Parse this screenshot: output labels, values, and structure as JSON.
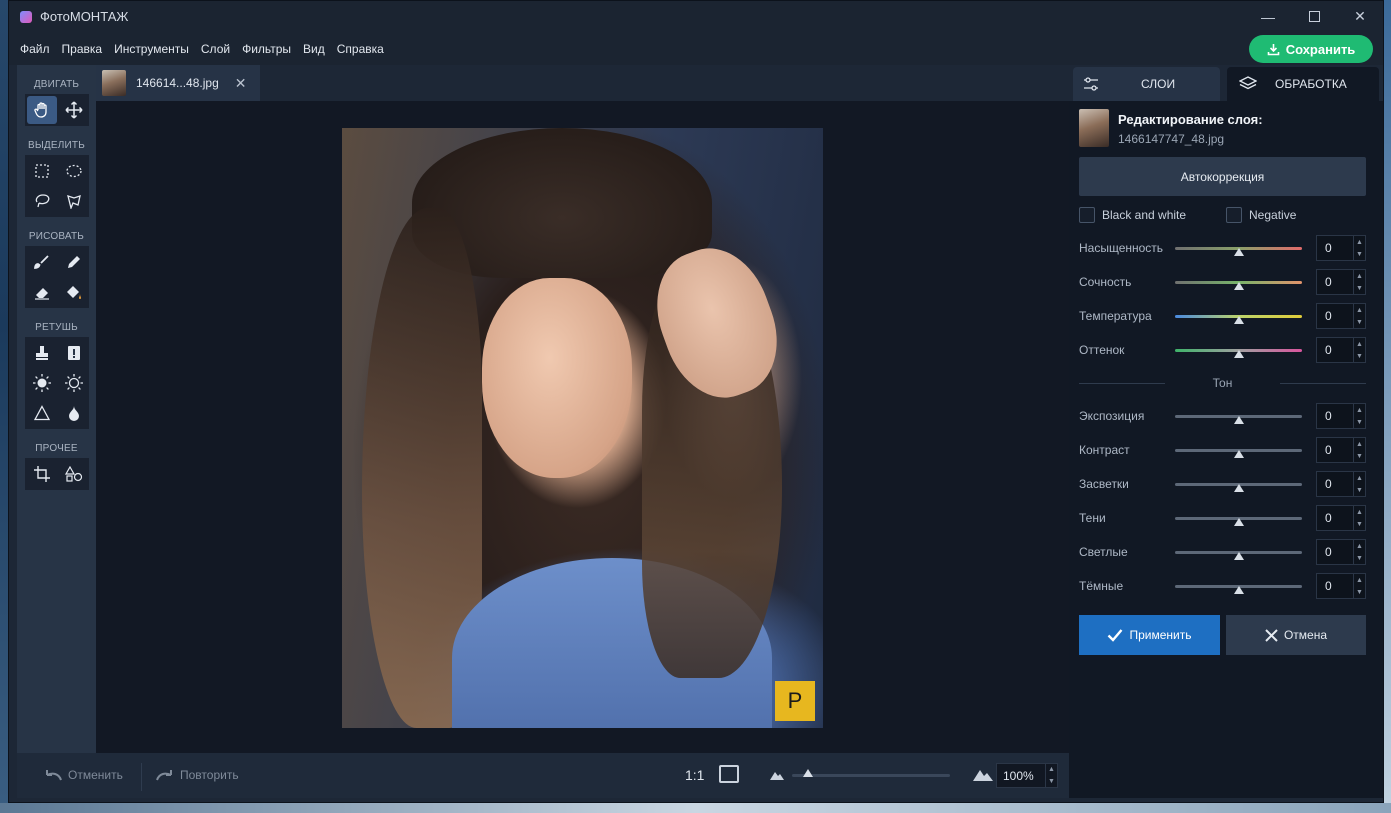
{
  "window": {
    "title": "ФотоМОНТАЖ"
  },
  "menu": [
    "Файл",
    "Правка",
    "Инструменты",
    "Слой",
    "Фильтры",
    "Вид",
    "Справка"
  ],
  "save_button": "Сохранить",
  "toolbox": {
    "sections": [
      {
        "label": "ДВИГАТЬ",
        "tools": [
          "hand-tool",
          "move-tool"
        ]
      },
      {
        "label": "ВЫДЕЛИТЬ",
        "tools": [
          "rect-select-tool",
          "ellipse-select-tool",
          "lasso-tool",
          "polygon-lasso-tool"
        ]
      },
      {
        "label": "РИСОВАТЬ",
        "tools": [
          "brush-tool",
          "pencil-tool",
          "eraser-tool",
          "fill-tool"
        ]
      },
      {
        "label": "РЕТУШЬ",
        "tools": [
          "stamp-tool",
          "healing-tool",
          "dodge-tool",
          "burn-tool",
          "sharpen-tool",
          "blur-tool"
        ]
      },
      {
        "label": "ПРОЧЕЕ",
        "tools": [
          "crop-tool",
          "shapes-tool"
        ]
      }
    ]
  },
  "document_tab": {
    "name": "146614...48.jpg"
  },
  "photo_badge": "P",
  "bottombar": {
    "undo": "Отменить",
    "redo": "Повторить",
    "ratio": "1:1",
    "zoom": "100%",
    "zoom_slider_fraction": 0.1
  },
  "right_panel": {
    "tabs": [
      "СЛОИ",
      "ОБРАБОТКА"
    ],
    "active_tab": "ОБРАБОТКА",
    "layer_title": "Редактирование слоя:",
    "layer_file": "1466147747_48.jpg",
    "auto_button": "Автокоррекция",
    "checkbox_bw": "Black and white",
    "checkbox_negative": "Negative",
    "sliders_color": [
      {
        "label": "Насыщенность",
        "value": "0"
      },
      {
        "label": "Сочность",
        "value": "0"
      },
      {
        "label": "Температура",
        "value": "0"
      },
      {
        "label": "Оттенок",
        "value": "0"
      }
    ],
    "tone_header": "Тон",
    "sliders_tone": [
      {
        "label": "Экспозиция",
        "value": "0"
      },
      {
        "label": "Контраст",
        "value": "0"
      },
      {
        "label": "Засветки",
        "value": "0"
      },
      {
        "label": "Тени",
        "value": "0"
      },
      {
        "label": "Светлые",
        "value": "0"
      },
      {
        "label": "Тёмные",
        "value": "0"
      }
    ],
    "apply_button": "Применить",
    "cancel_button": "Отмена"
  },
  "colors": {
    "accent_green": "#1fbb73",
    "accent_blue": "#1e6fc2",
    "badge_yellow": "#e7b71f"
  }
}
